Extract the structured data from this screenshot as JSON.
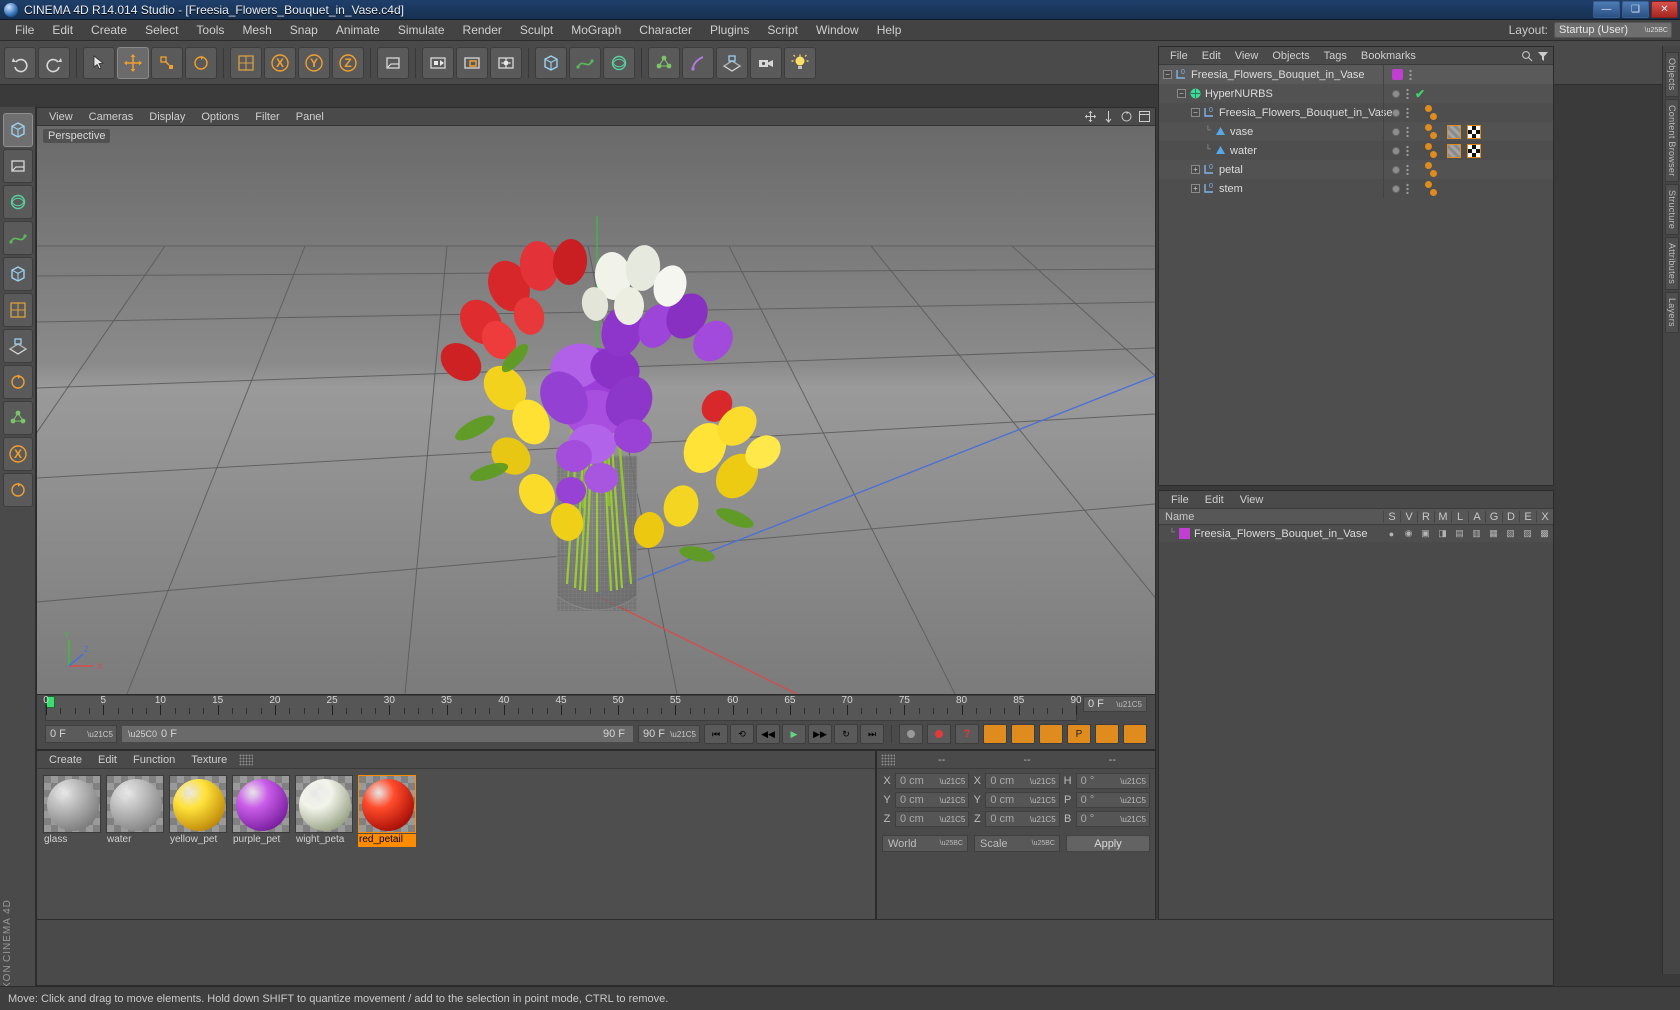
{
  "window": {
    "title": "CINEMA 4D R14.014 Studio - [Freesia_Flowers_Bouquet_in_Vase.c4d]",
    "minimize": "—",
    "maximize": "❑",
    "close": "✕"
  },
  "menubar": {
    "items": [
      "File",
      "Edit",
      "Create",
      "Select",
      "Tools",
      "Mesh",
      "Snap",
      "Animate",
      "Simulate",
      "Render",
      "Sculpt",
      "MoGraph",
      "Character",
      "Plugins",
      "Script",
      "Window",
      "Help"
    ],
    "layout_label": "Layout:",
    "layout_value": "Startup (User)"
  },
  "toolbar": {
    "buttons": [
      {
        "name": "undo-button",
        "icon": "undo",
        "label": "Undo"
      },
      {
        "name": "redo-button",
        "icon": "redo",
        "label": "Redo"
      },
      {
        "name": "select-live-button",
        "icon": "cursor",
        "label": "Live Selection"
      },
      {
        "name": "move-button",
        "icon": "move",
        "label": "Move",
        "active": true
      },
      {
        "name": "scale-button",
        "icon": "scale",
        "label": "Scale"
      },
      {
        "name": "rotate-button",
        "icon": "rotate",
        "label": "Rotate"
      },
      {
        "name": "axis-world-button",
        "icon": "axis",
        "label": "World/Object"
      },
      {
        "name": "lock-x-button",
        "icon": "X",
        "label": "X Axis"
      },
      {
        "name": "lock-y-button",
        "icon": "Y",
        "label": "Y Axis"
      },
      {
        "name": "lock-z-button",
        "icon": "Z",
        "label": "Z Axis"
      },
      {
        "name": "coordinate-system-button",
        "icon": "coordsys",
        "label": "Coordinate System"
      },
      {
        "name": "render-view-button",
        "icon": "render",
        "label": "Render View"
      },
      {
        "name": "render-region-button",
        "icon": "renderregion",
        "label": "Render Region"
      },
      {
        "name": "render-settings-button",
        "icon": "rendersettings",
        "label": "Render Settings"
      },
      {
        "name": "cube-button",
        "icon": "cube",
        "label": "Add Cube Object"
      },
      {
        "name": "spline-button",
        "icon": "spline",
        "label": "Add Spline"
      },
      {
        "name": "nurbs-button",
        "icon": "nurbs",
        "label": "Add NURBS Object"
      },
      {
        "name": "array-button",
        "icon": "array",
        "label": "Add Array Object"
      },
      {
        "name": "deformer-button",
        "icon": "deformer",
        "label": "Add Bend Object"
      },
      {
        "name": "environment-button",
        "icon": "floor",
        "label": "Add Floor"
      },
      {
        "name": "camera-button",
        "icon": "camera",
        "label": "Add Camera"
      },
      {
        "name": "light-button",
        "icon": "light",
        "label": "Add Light"
      }
    ]
  },
  "left_toolbar": {
    "buttons": [
      {
        "name": "model-mode-button",
        "label": "Model Mode"
      },
      {
        "name": "texture-mode-button",
        "label": "Texture Mode"
      },
      {
        "name": "points-mode-button",
        "label": "Points Mode"
      },
      {
        "name": "edges-mode-button",
        "label": "Edges Mode"
      },
      {
        "name": "polygons-mode-button",
        "label": "Polygons Mode"
      },
      {
        "name": "object-axis-button",
        "label": "Object Axis"
      },
      {
        "name": "workplane-button",
        "label": "Workplane"
      },
      {
        "name": "enable-axis-button",
        "label": "Enable Axis"
      },
      {
        "name": "viewport-solo-button",
        "label": "Viewport Solo"
      },
      {
        "name": "lock-button",
        "label": "Lock"
      },
      {
        "name": "animation-mode-button",
        "label": "Animation Mode"
      }
    ],
    "brand_line1": "MAXON",
    "brand_line2": "CINEMA 4D"
  },
  "viewport": {
    "menu": [
      "View",
      "Cameras",
      "Display",
      "Options",
      "Filter",
      "Panel"
    ],
    "label": "Perspective",
    "axis": {
      "x": "X",
      "y": "Y",
      "z": "Z"
    }
  },
  "timeline": {
    "frame_field": "0 F",
    "frame_field_right": "0 F",
    "current_frame": "0 F",
    "range_value": "0 F",
    "range_end": "90 F",
    "end_frame": "90 F",
    "ticks": [
      "0",
      "5",
      "10",
      "15",
      "20",
      "25",
      "30",
      "35",
      "40",
      "45",
      "50",
      "55",
      "60",
      "65",
      "70",
      "75",
      "80",
      "85",
      "90"
    ],
    "transport": [
      {
        "name": "goto-start-button",
        "glyph": "⏮"
      },
      {
        "name": "loop-button",
        "glyph": "⟲"
      },
      {
        "name": "step-back-button",
        "glyph": "◀◀"
      },
      {
        "name": "play-button",
        "glyph": "▶"
      },
      {
        "name": "step-forward-button",
        "glyph": "▶▶"
      },
      {
        "name": "play-reverse-button",
        "glyph": "↻"
      },
      {
        "name": "goto-end-button",
        "glyph": "⏭"
      }
    ]
  },
  "material_manager": {
    "menu": [
      "Create",
      "Edit",
      "Function",
      "Texture"
    ],
    "materials": [
      {
        "name": "glass",
        "color1": "#bdbdbd",
        "color2": "#7d7d7d",
        "selected": false
      },
      {
        "name": "water",
        "color1": "#c3c3c3",
        "color2": "#868686",
        "selected": false
      },
      {
        "name": "yellow_pet",
        "color1": "#ffe23a",
        "color2": "#c08a0a",
        "selected": false
      },
      {
        "name": "purple_pet",
        "color1": "#c95ce8",
        "color2": "#7a1fa0",
        "selected": false
      },
      {
        "name": "wight_peta",
        "color1": "#f2f4ea",
        "color2": "#9aa487",
        "selected": false
      },
      {
        "name": "red_petail",
        "color1": "#ff4b2a",
        "color2": "#a80f08",
        "selected": true
      }
    ]
  },
  "coordinates": {
    "headers": [
      "--",
      "--",
      "--"
    ],
    "position": {
      "label_x": "X",
      "label_y": "Y",
      "label_z": "Z",
      "x": "0 cm",
      "y": "0 cm",
      "z": "0 cm"
    },
    "size": {
      "label_x": "X",
      "label_y": "Y",
      "label_z": "Z",
      "x": "0 cm",
      "y": "0 cm",
      "z": "0 cm"
    },
    "rotation": {
      "label_h": "H",
      "label_p": "P",
      "label_b": "B",
      "h": "0 °",
      "p": "0 °",
      "b": "0 °"
    },
    "system": "World",
    "mode": "Scale",
    "apply": "Apply"
  },
  "object_manager": {
    "menu": [
      "File",
      "Edit",
      "View",
      "Objects",
      "Tags",
      "Bookmarks"
    ],
    "rows": [
      {
        "name": "Freesia_Flowers_Bouquet_in_Vase",
        "depth": 0,
        "icon": "null",
        "expander": "minus",
        "color": "#c13fd0",
        "tags": []
      },
      {
        "name": "HyperNURBS",
        "depth": 1,
        "icon": "hypernurbs",
        "expander": "minus",
        "check": true,
        "tags": []
      },
      {
        "name": "Freesia_Flowers_Bouquet_in_Vase",
        "depth": 2,
        "icon": "null",
        "expander": "minus",
        "tags": [
          "ball",
          "ball"
        ]
      },
      {
        "name": "vase",
        "depth": 3,
        "icon": "polygon",
        "expander": "none",
        "tags": [
          "ball",
          "ball",
          "texture",
          "checker"
        ]
      },
      {
        "name": "water",
        "depth": 3,
        "icon": "polygon",
        "expander": "none",
        "tags": [
          "ball",
          "ball",
          "texture",
          "checker"
        ]
      },
      {
        "name": "petal",
        "depth": 2,
        "icon": "null",
        "expander": "plus",
        "tags": [
          "ball",
          "ball"
        ]
      },
      {
        "name": "stem",
        "depth": 2,
        "icon": "null",
        "expander": "plus",
        "tags": [
          "ball",
          "ball"
        ]
      }
    ]
  },
  "attribute_manager": {
    "menu": [
      "File",
      "Edit",
      "View"
    ],
    "layer_columns": [
      "Name",
      "S",
      "V",
      "R",
      "M",
      "L",
      "A",
      "G",
      "D",
      "E",
      "X"
    ],
    "layers": [
      {
        "name": "Freesia_Flowers_Bouquet_in_Vase",
        "color": "#c13fd0"
      }
    ]
  },
  "right_tabs": [
    "Objects",
    "Content Browser",
    "Structure",
    "Attributes",
    "Layers"
  ],
  "statusbar": {
    "message": "Move: Click and drag to move elements. Hold down SHIFT to quantize movement / add to the selection in point mode, CTRL to remove."
  }
}
